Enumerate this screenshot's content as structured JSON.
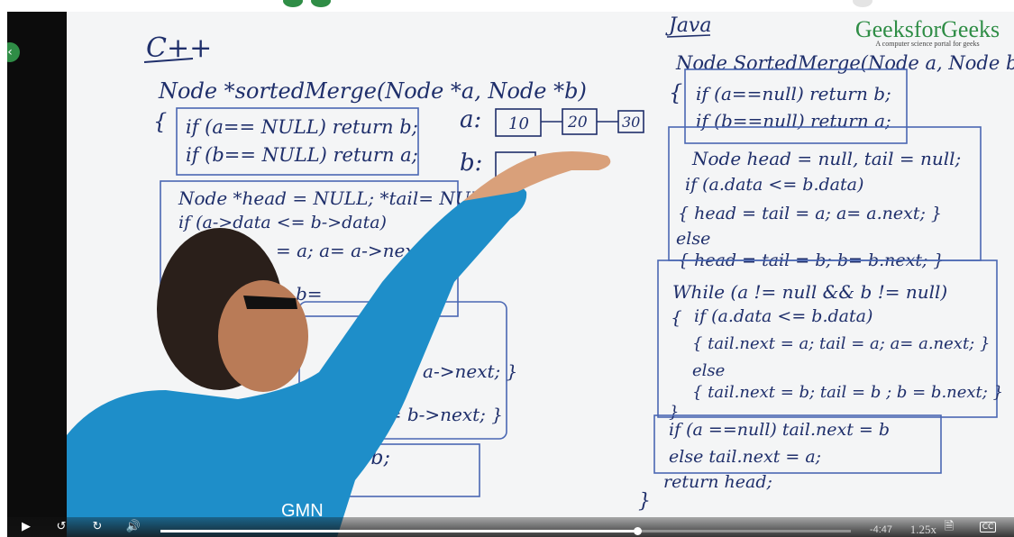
{
  "window": {
    "accent_color": "#2f8d46"
  },
  "brand": {
    "name": "GeeksforGeeks",
    "tagline": "A computer science portal for geeks"
  },
  "board": {
    "cpp": {
      "heading": "C++",
      "signature": "Node *sortedMerge(Node *a, Node *b)",
      "open_brace": "{",
      "null_checks": [
        "if (a== NULL) return b;",
        "if (b== NULL) return a;"
      ],
      "init_line": "Node *head = NULL; *tail= NULL;",
      "cond_line": "if (a->data <= b->data)",
      "assign_line": "= a;   a= a->next",
      "b_line": "b=",
      "next_a": "a= a->next; }",
      "next_b": "b;  b= b->next; }",
      "tail_b": "= b;"
    },
    "diagram": {
      "label_a": "a:",
      "label_b": "b:",
      "nodes_a": [
        "10",
        "20",
        "30"
      ]
    },
    "java": {
      "heading": "Java",
      "signature": "Node SortedMerge(Node a, Node b)",
      "open_brace": "{",
      "null_checks": [
        "if (a==null) return b;",
        "if (b==null) return a;"
      ],
      "init_line": "Node head = null, tail = null;",
      "cond_line": "if (a.data <= b.data)",
      "then_line": "{ head = tail = a;   a= a.next; }",
      "else_word": "else",
      "else_line": "{ head = tail = b;   b= b.next; }",
      "while_line": "While (a != null && b != null)",
      "inner_open": "{",
      "inner_cond": "if (a.data <= b.data)",
      "inner_then": "{ tail.next = a;   tail = a;   a= a.next; }",
      "inner_else_word": "else",
      "inner_else": "{ tail.next = b;  tail = b ;  b = b.next; }",
      "inner_close": "}",
      "tail_if": "if (a ==null)   tail.next = b",
      "tail_else": "else   tail.next = a;",
      "return_line": "return head;",
      "close_brace": "}"
    }
  },
  "player": {
    "controls": {
      "play_icon": "play-icon",
      "rewind_icon": "replay-10-icon",
      "forward_icon": "forward-10-icon",
      "volume_icon": "volume-icon",
      "transcript_icon": "document-icon",
      "captions_icon": "cc-icon"
    },
    "progress_fraction": 0.69,
    "time_remaining": "-4:47",
    "speed": "1.25x"
  }
}
